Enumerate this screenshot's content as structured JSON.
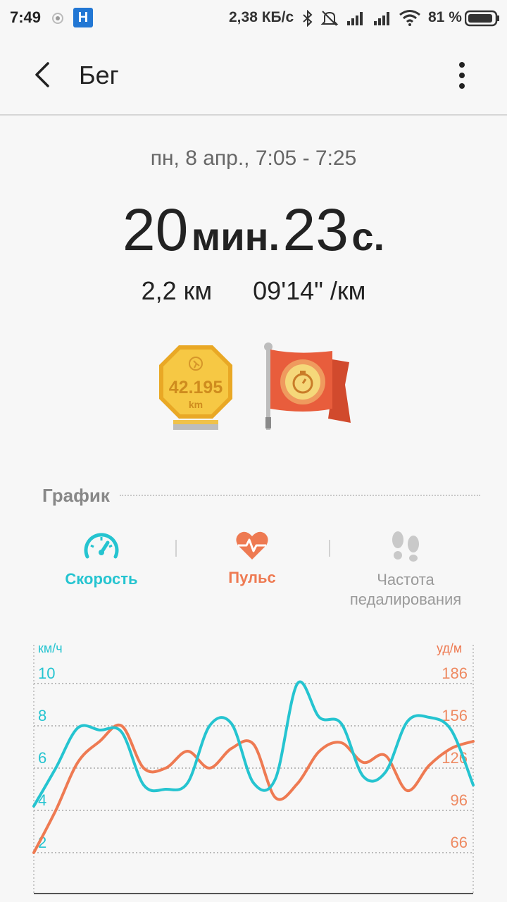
{
  "status_bar": {
    "time": "7:49",
    "notification_badge": "H",
    "net_speed": "2,38 КБ/с",
    "battery": "81 %",
    "icons": [
      "wifi-hotspot-icon",
      "bluetooth-icon",
      "mute-icon",
      "signal-icon",
      "signal-icon",
      "wifi-icon",
      "battery-icon"
    ]
  },
  "app_bar": {
    "title": "Бег"
  },
  "workout": {
    "date": "пн, 8 апр., 7:05 - 7:25",
    "duration_min": "20",
    "duration_min_unit": "мин.",
    "duration_sec": "23",
    "duration_sec_unit": "с.",
    "distance": "2,2 км",
    "pace": "09'14\" /км"
  },
  "badges": {
    "marathon_value": "42.195",
    "marathon_unit": "km",
    "icons": [
      "marathon-medal-icon",
      "stopwatch-flag-icon"
    ]
  },
  "graph": {
    "section_title": "График",
    "tabs": [
      {
        "label": "Скорость",
        "icon": "speedometer-icon",
        "color": "#25c4d0",
        "active": true
      },
      {
        "label": "Пульс",
        "icon": "heart-pulse-icon",
        "color": "#ee7a52",
        "active": false
      },
      {
        "label": "Частота педалирования",
        "icon": "footsteps-icon",
        "color": "#9a9a9a",
        "active": false
      }
    ]
  },
  "chart_data": {
    "type": "line",
    "left_axis": {
      "label": "км/ч",
      "ticks": [
        "10",
        "8",
        "6",
        "4",
        "2"
      ],
      "range": [
        1,
        11
      ]
    },
    "right_axis": {
      "label": "уд/м",
      "ticks": [
        "186",
        "156",
        "126",
        "96",
        "66"
      ],
      "range": [
        51,
        201
      ]
    },
    "grid": true,
    "x": [
      0,
      1,
      2,
      3,
      4,
      5,
      6,
      7,
      8,
      9,
      10,
      11,
      12,
      13,
      14,
      15,
      16,
      17,
      18,
      19,
      20
    ],
    "series": [
      {
        "color": "#25c4d0",
        "axis": "left",
        "values": [
          4.2,
          6.0,
          7.9,
          7.8,
          7.7,
          5.2,
          5.0,
          5.3,
          8.0,
          8.1,
          5.3,
          5.5,
          10.0,
          8.4,
          8.1,
          5.6,
          5.8,
          8.2,
          8.4,
          7.8,
          5.2
        ]
      },
      {
        "color": "#ee7a52",
        "axis": "right",
        "values": [
          66,
          96,
          130,
          145,
          156,
          126,
          126,
          138,
          126,
          140,
          143,
          105,
          115,
          138,
          144,
          130,
          135,
          110,
          128,
          140,
          145
        ]
      }
    ]
  }
}
